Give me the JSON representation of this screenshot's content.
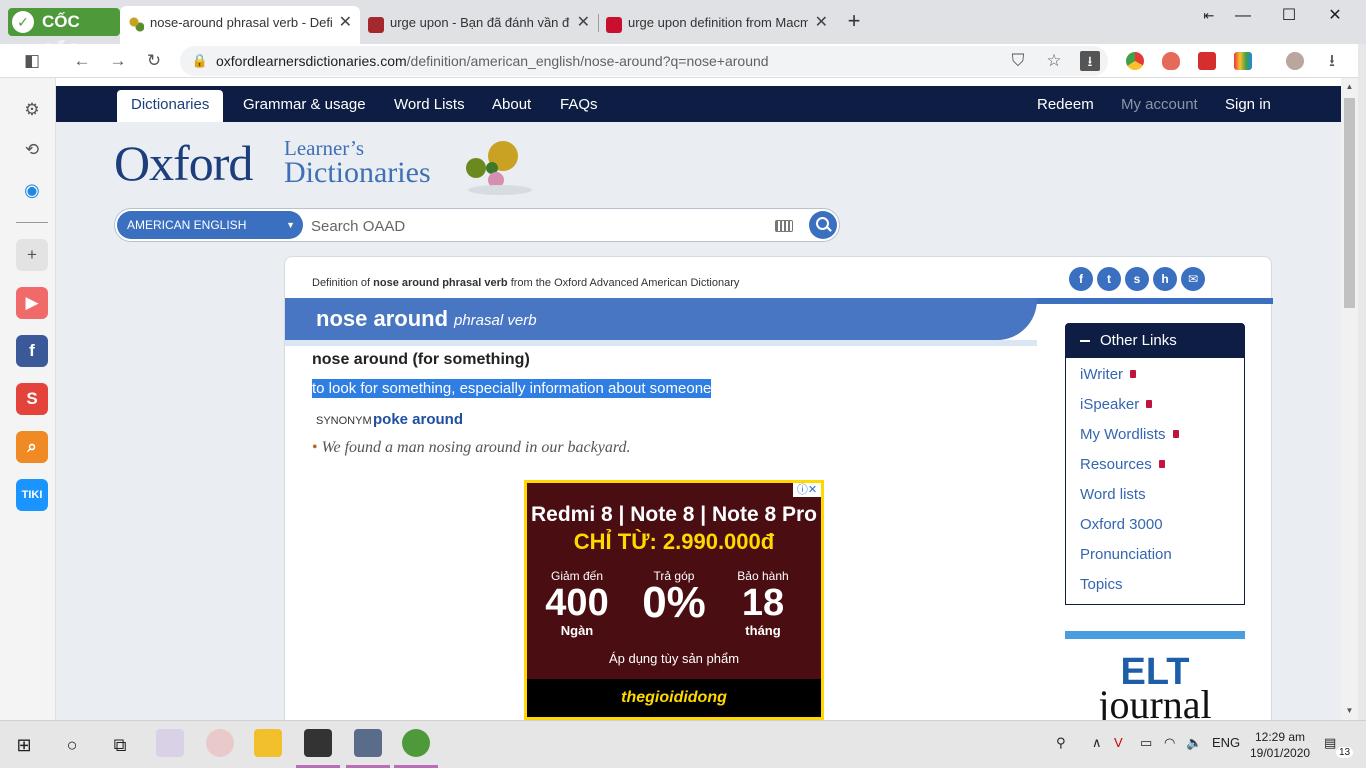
{
  "browser": {
    "logo": "CỐC CỐC",
    "tabs": [
      {
        "title": "nose-around phrasal verb - Definit"
      },
      {
        "title": "urge upon - Bạn đã đánh vần đúng"
      },
      {
        "title": "urge upon definition from Macmill"
      }
    ],
    "url_host": "oxfordlearnersdictionaries.com",
    "url_path": "/definition/american_english/nose-around?q=nose+around"
  },
  "nav": {
    "dictionaries": "Dictionaries",
    "grammar": "Grammar & usage",
    "wordlists": "Word Lists",
    "about": "About",
    "faqs": "FAQs",
    "redeem": "Redeem",
    "myaccount": "My account",
    "signin": "Sign in"
  },
  "logo": {
    "oxford": "Oxford",
    "line1": "Learner’s",
    "line2": "Dictionaries"
  },
  "search": {
    "dictionary": "AMERICAN ENGLISH",
    "placeholder": "Search OAAD"
  },
  "entry": {
    "def_prefix": "Definition of ",
    "def_word": "nose around phrasal verb",
    "def_suffix": " from the Oxford Advanced American Dictionary",
    "headword": "nose around",
    "pos": "phrasal verb",
    "sense_head": "nose around (for something)",
    "definition": "to look for something, especially information about someone",
    "synonym_label": "SYNONYM",
    "synonym": "poke around",
    "example": "We found a man nosing around in our backyard."
  },
  "ad": {
    "title": "Redmi 8 | Note 8 | Note 8 Pro",
    "price": "CHỈ TỪ: 2.990.000đ",
    "col1_label": "Giảm đến",
    "col1_big": "400",
    "col1_sub": "Ngàn",
    "col2_label": "Trả góp",
    "col2_big": "0%",
    "col3_label": "Bảo hành",
    "col3_big": "18",
    "col3_sub": "tháng",
    "note": "Áp dụng tùy sản phẩm",
    "brand": "thegioididong"
  },
  "other_links": {
    "title": "Other Links",
    "items": [
      "iWriter",
      "iSpeaker",
      "My Wordlists",
      "Resources",
      "Word lists",
      "Oxford 3000",
      "Pronunciation",
      "Topics"
    ]
  },
  "elt": {
    "line1": "ELT",
    "line2": "journal"
  },
  "taskbar": {
    "lang": "ENG",
    "time": "12:29 am",
    "date": "19/01/2020",
    "notif": "13"
  }
}
